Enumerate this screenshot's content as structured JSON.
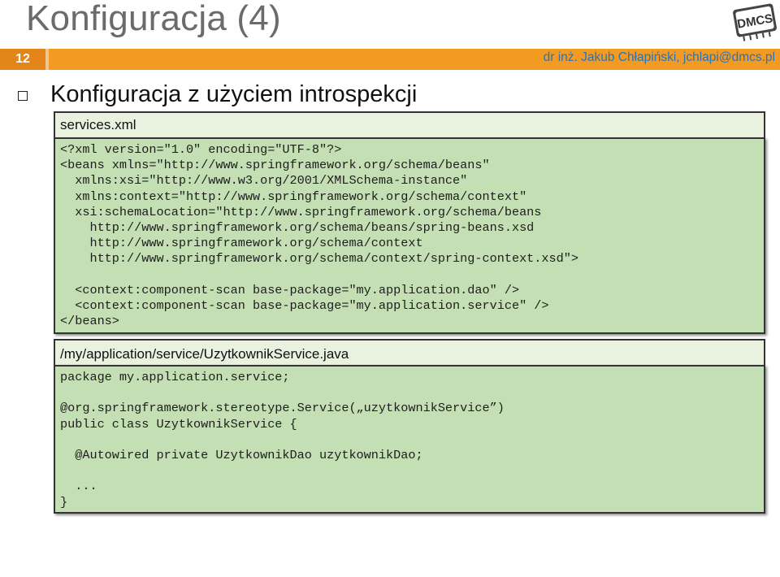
{
  "slide": {
    "title": "Konfiguracja (4)",
    "number": "12",
    "author": "dr inż. Jakub Chłapiński, jchlapi@dmcs.pl",
    "logo_text": "DMCS"
  },
  "bullet": {
    "text": "Konfiguracja z użyciem introspekcji"
  },
  "xml_panel": {
    "header": "services.xml",
    "code": "<?xml version=\"1.0\" encoding=\"UTF-8\"?>\n<beans xmlns=\"http://www.springframework.org/schema/beans\"\n  xmlns:xsi=\"http://www.w3.org/2001/XMLSchema-instance\"\n  xmlns:context=\"http://www.springframework.org/schema/context\"\n  xsi:schemaLocation=\"http://www.springframework.org/schema/beans\n    http://www.springframework.org/schema/beans/spring-beans.xsd\n    http://www.springframework.org/schema/context\n    http://www.springframework.org/schema/context/spring-context.xsd\">\n\n  <context:component-scan base-package=\"my.application.dao\" />\n  <context:component-scan base-package=\"my.application.service\" />\n</beans>"
  },
  "java_panel": {
    "header": "/my/application/service/UzytkownikService.java",
    "code": "package my.application.service;\n\n@org.springframework.stereotype.Service(„uzytkownikService”)\npublic class UzytkownikService {\n\n  @Autowired private UzytkownikDao uzytkownikDao;\n\n  ...\n}"
  }
}
